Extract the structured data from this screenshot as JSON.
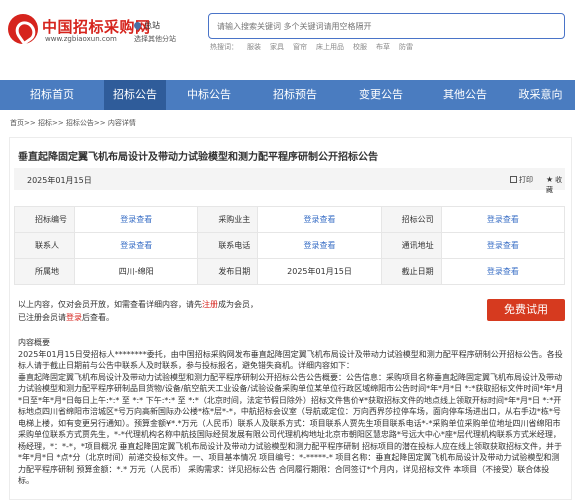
{
  "header": {
    "logo_cn": "中国招标采购网",
    "logo_en": "www.zgbiaoxun.com",
    "site_label": "总站",
    "site_switch": "选择其他分站",
    "search_placeholder": "请输入搜索关键词 多个关键词请用空格隔开",
    "hot_label": "热搜词：",
    "hot_words": [
      "服装",
      "家具",
      "窗帘",
      "床上用品",
      "校服",
      "布草",
      "防雷"
    ]
  },
  "nav": {
    "items": [
      "招标首页",
      "招标公告",
      "中标公告",
      "招标预告",
      "变更公告",
      "其他公告",
      "政采意向"
    ]
  },
  "breadcrumb": "首页>> 招标>> 招标公告>> 内容详情",
  "notice": {
    "title": "垂直起降固定翼飞机布局设计及带动力试验模型和测力配平程序研制公开招标公告",
    "date": "2025年01月15日",
    "print_label": "打印",
    "fav_label": "收藏"
  },
  "info_table": [
    [
      {
        "k": "招标编号",
        "v": "登录查看",
        "link": true
      },
      {
        "k": "采购业主",
        "v": "登录查看",
        "link": true
      },
      {
        "k": "招标公司",
        "v": "登录查看",
        "link": true
      }
    ],
    [
      {
        "k": "联系人",
        "v": "登录查看",
        "link": true
      },
      {
        "k": "联系电话",
        "v": "登录查看",
        "link": true
      },
      {
        "k": "通讯地址",
        "v": "登录查看",
        "link": true
      }
    ],
    [
      {
        "k": "所属地",
        "v": "四川-绵阳",
        "link": false
      },
      {
        "k": "发布日期",
        "v": "2025年01月15日",
        "link": false
      },
      {
        "k": "截止日期",
        "v": "登录查看",
        "link": true
      }
    ]
  ],
  "member_note": {
    "line1_a": "以上内容，仅对会员开放，如需查看详细内容，请先",
    "line1_register": "注册",
    "line1_b": "成为会员，",
    "line2_a": "已注册会员请",
    "line2_login": "登录",
    "line2_b": "后查看。"
  },
  "trial_button": "免费试用",
  "content": {
    "heading": "内容概要",
    "body": [
      "2025年01月15日受招标人********委托，由中国招标采购网发布垂直起降固定翼飞机布局设计及带动力试验模型和测力配平程序研制公开招标公告。各投标人请于截止日期前与公告中联系人及时联系，参与投标报名，避免错失商机。详细内容如下：",
      "垂直起降固定翼飞机布局设计及带动力试验模型和测力配平程序研制公开招标公告公告概要：公告信息：采购项目名称垂直起降固定翼飞机布局设计及带动力试验模型和测力配平程序研制品目货物/设备/航空航天工业设备/试验设备采购单位某单位行政区域绵阳市公告时间*年*月*日 *:*获取招标文件时间*年*月*日至*年*月*日每日上午:*:* 至 *:* 下午:*:* 至 *:*（北京时间，法定节假日除外）招标文件售价¥*获取招标文件的地点线上领取开标时间*年*月*日 *:*开标地点四川省绵阳市涪城区*号万向高新国际办公楼*栋*层*-*，中航招标会议室（导航或定位：万向西界莎拉停车场，面向停车场进出口，从右手边*栋*号电梯上楼，如有变更另行通知）。预算金额¥*.*万元（人民币）联系人及联系方式：项目联系人贾先生项目联系电话*-*采购单位采购单位地址四川省绵阳市采购单位联系方式贾先生，*-*代理机构名称中航技国际经贸发展有限公司代理机构地址北京市朝阳区慧忠路*号远大中心*座*层代理机构联系方式米经理，杨经理，*：*-*，*项目概况 垂直起降固定翼飞机布局设计及带动力试验模型和测力配平程序研制 招标项目的潜在投标人应在线上领取获取招标文件，并于*年*月*日 *点*分（北京时间）前递交投标文件。一、项目基本情况 项目编号：*-*****-* 项目名称：垂直起降固定翼飞机布局设计及带动力试验模型和测力配平程序研制 预算金额：*.* 万元（人民币） 采购需求：详见招标公告 合同履行期限：合同签订*个月内，详见招标文件 本项目（不接受）联合体投标。"
    ]
  }
}
